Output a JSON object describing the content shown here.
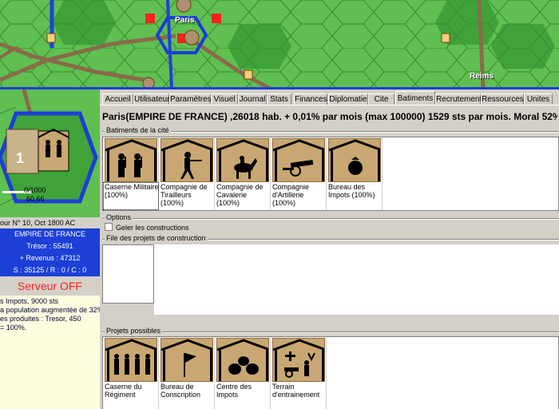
{
  "map": {
    "city_labels": [
      "Paris",
      "Reims"
    ]
  },
  "left": {
    "stack_count": "0/1000",
    "stack_sub": "60,66",
    "turn": "our N° 10, Oct 1800 AC",
    "empire": "EMPIRE DE FRANCE",
    "tresor": "Trésor : 55491",
    "revenus": "+ Revenus : 47312",
    "stats": "S : 35125 / R : 0 / C : 0",
    "server_status": "Serveur OFF",
    "messages": [
      "s Impots, 9000 sts",
      "a population augmentée de 32%",
      "es produites : Tresor, 450",
      "= 100%."
    ]
  },
  "tabs": [
    "Accueil",
    "Utilisateur",
    "Paramètres",
    "Visuel",
    "Journal",
    "Stats",
    "Finances",
    "Diplomatie",
    "Cite",
    "Batiments",
    "Recrutement",
    "Ressources",
    "Unites"
  ],
  "active_tab": "Batiments",
  "city_header": "Paris(EMPIRE DE FRANCE) ,26018 hab. + 0,01% par mois (max 100000) 1529 sts par mois. Moral 52% (+",
  "sections": {
    "buildings_title": "Batiments de la cité",
    "options_title": "Options",
    "freeze_label": "Geler les constructions",
    "queue_title": "File des projets de construction",
    "possible_title": "Projets possibles"
  },
  "buildings": [
    {
      "label": "Caserne Militaire (100%)",
      "icon": "infantry-icon"
    },
    {
      "label": "Compagnie de Tirailleurs (100%)",
      "icon": "skirmisher-icon"
    },
    {
      "label": "Compagnie de Cavalerie (100%)",
      "icon": "cavalry-icon"
    },
    {
      "label": "Compagnie d'Artillerie (100%)",
      "icon": "cannon-icon"
    },
    {
      "label": "Bureau des Impots (100%)",
      "icon": "money-bag-icon"
    }
  ],
  "possible_projects": [
    {
      "label": "Caserne du Régiment",
      "icon": "infantry-icon"
    },
    {
      "label": "Bureau de Conscription",
      "icon": "flag-icon"
    },
    {
      "label": "Centre des Impots",
      "icon": "money-bags-icon"
    },
    {
      "label": "Terrain d'entrainement",
      "icon": "training-icon"
    }
  ],
  "colors": {
    "map_green": "#5fbf50",
    "panel_blue": "#1c3fd6",
    "server_red": "#ff2020"
  }
}
